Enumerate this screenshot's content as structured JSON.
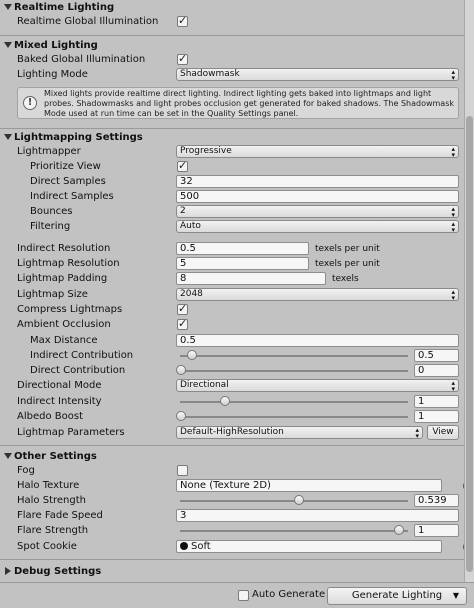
{
  "realtime": {
    "header": "Realtime Lighting",
    "gi_label": "Realtime Global Illumination",
    "gi_checked": true
  },
  "mixed": {
    "header": "Mixed Lighting",
    "baked_gi_label": "Baked Global Illumination",
    "baked_gi_checked": true,
    "mode_label": "Lighting Mode",
    "mode_value": "Shadowmask",
    "info_text": "Mixed lights provide realtime direct lighting. Indirect lighting gets baked into lightmaps and light probes. Shadowmasks and light probes occlusion get generated for baked shadows. The Shadowmask Mode used at run time can be set in the Quality Settings panel.",
    "info_icon": "info-icon"
  },
  "lightmapping": {
    "header": "Lightmapping Settings",
    "lightmapper_label": "Lightmapper",
    "lightmapper_value": "Progressive",
    "prioritize_label": "Prioritize View",
    "prioritize_checked": true,
    "direct_samples_label": "Direct Samples",
    "direct_samples_value": "32",
    "indirect_samples_label": "Indirect Samples",
    "indirect_samples_value": "500",
    "bounces_label": "Bounces",
    "bounces_value": "2",
    "filtering_label": "Filtering",
    "filtering_value": "Auto",
    "indirect_res_label": "Indirect Resolution",
    "indirect_res_value": "0.5",
    "indirect_res_unit": "texels per unit",
    "lightmap_res_label": "Lightmap Resolution",
    "lightmap_res_value": "5",
    "lightmap_res_unit": "texels per unit",
    "padding_label": "Lightmap Padding",
    "padding_value": "8",
    "padding_unit": "texels",
    "size_label": "Lightmap Size",
    "size_value": "2048",
    "compress_label": "Compress Lightmaps",
    "compress_checked": true,
    "ao_label": "Ambient Occlusion",
    "ao_checked": true,
    "max_distance_label": "Max Distance",
    "max_distance_value": "0.5",
    "indirect_contrib_label": "Indirect Contribution",
    "indirect_contrib_value": "0.5",
    "indirect_contrib_fraction": 0.05,
    "direct_contrib_label": "Direct Contribution",
    "direct_contrib_value": "0",
    "direct_contrib_fraction": 0.0,
    "directional_label": "Directional Mode",
    "directional_value": "Directional",
    "indirect_intensity_label": "Indirect Intensity",
    "indirect_intensity_value": "1",
    "indirect_intensity_fraction": 0.2,
    "albedo_label": "Albedo Boost",
    "albedo_value": "1",
    "albedo_fraction": 0.0,
    "params_label": "Lightmap Parameters",
    "params_value": "Default-HighResolution",
    "view_button": "View"
  },
  "other": {
    "header": "Other Settings",
    "fog_label": "Fog",
    "fog_checked": false,
    "halo_texture_label": "Halo Texture",
    "halo_texture_value": "None (Texture 2D)",
    "halo_strength_label": "Halo Strength",
    "halo_strength_value": "0.539",
    "halo_strength_fraction": 0.539,
    "flare_fade_label": "Flare Fade Speed",
    "flare_fade_value": "3",
    "flare_strength_label": "Flare Strength",
    "flare_strength_value": "1",
    "flare_strength_fraction": 1.0,
    "spot_cookie_label": "Spot Cookie",
    "spot_cookie_value": "Soft"
  },
  "debug": {
    "header": "Debug Settings"
  },
  "bottom": {
    "auto_generate_label": "Auto Generate",
    "auto_generate_checked": false,
    "generate_button": "Generate Lighting"
  }
}
